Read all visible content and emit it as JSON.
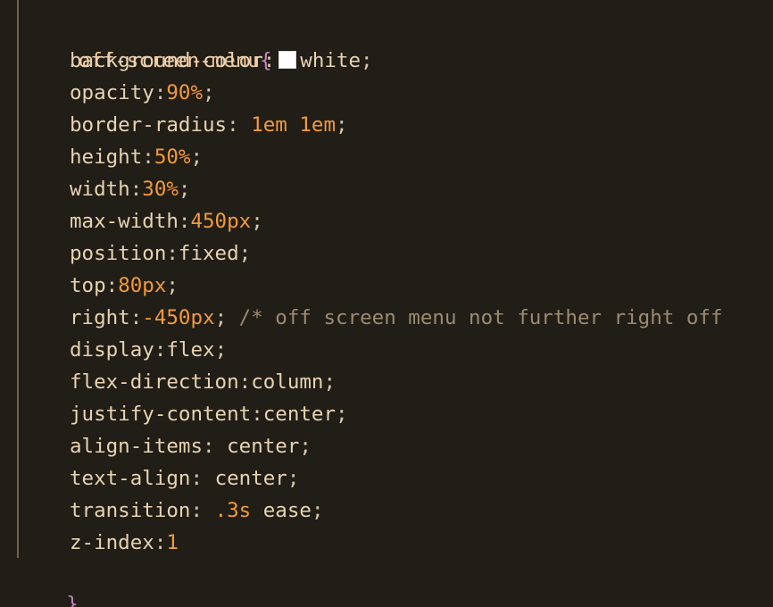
{
  "code": {
    "selector_dot": ".",
    "selector_name": "off-screen-menu",
    "open_brace": "{",
    "close_brace": "}",
    "declarations": [
      {
        "prop": "background-color",
        "sep": ":",
        "swatch_color": "#ffffff",
        "value_text": "white",
        "end": ";"
      },
      {
        "prop": "opacity",
        "sep": ":",
        "value_num": "90%",
        "end": ";"
      },
      {
        "prop": "border-radius",
        "sep": ": ",
        "value_num": "1em 1em",
        "end": ";"
      },
      {
        "prop": "height",
        "sep": ":",
        "value_num": "50%",
        "end": ";"
      },
      {
        "prop": "width",
        "sep": ":",
        "value_num": "30%",
        "end": ";"
      },
      {
        "prop": "max-width",
        "sep": ":",
        "value_num": "450px",
        "end": ";"
      },
      {
        "prop": "position",
        "sep": ":",
        "value_text": "fixed",
        "end": ";"
      },
      {
        "prop": "top",
        "sep": ":",
        "value_num": "80px",
        "end": ";"
      },
      {
        "prop": "right",
        "sep": ":",
        "value_num": "-450px",
        "end": ";",
        "comment": " /* off screen menu not further right off"
      },
      {
        "prop": "display",
        "sep": ":",
        "value_text": "flex",
        "end": ";"
      },
      {
        "prop": "flex-direction",
        "sep": ":",
        "value_text": "column",
        "end": ";"
      },
      {
        "prop": "justify-content",
        "sep": ":",
        "value_text": "center",
        "end": ";"
      },
      {
        "prop": "align-items",
        "sep": ": ",
        "value_text": "center",
        "end": ";"
      },
      {
        "prop": "text-align",
        "sep": ": ",
        "value_text": "center",
        "end": ";"
      },
      {
        "prop": "transition",
        "sep": ": ",
        "value_num": ".3s",
        "value_text2": " ease",
        "end": ";"
      },
      {
        "prop": "z-index",
        "sep": ":",
        "value_num": "1",
        "end": ""
      }
    ]
  },
  "colors": {
    "background": "#211d17",
    "property": "#e8d3b0",
    "number": "#f39a3b",
    "brace": "#c586c0",
    "comment": "#9d8b70",
    "selector": "#f2c79a"
  }
}
